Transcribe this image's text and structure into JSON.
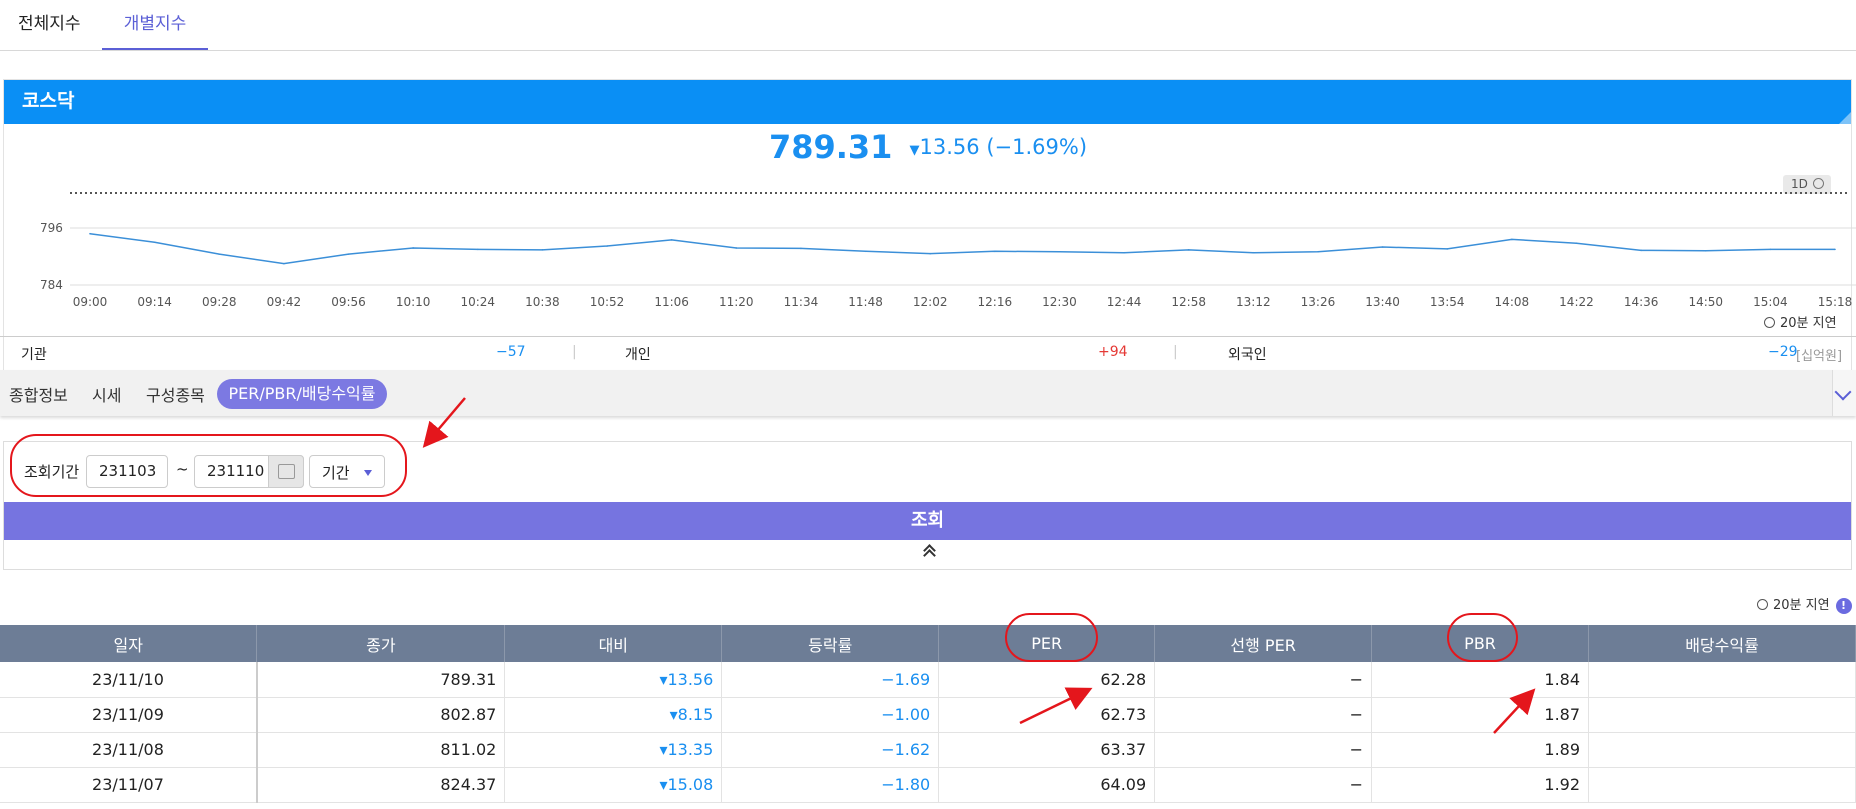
{
  "top_tabs": [
    "전체지수",
    "개별지수"
  ],
  "card": {
    "title": "코스닥",
    "price": "789.31",
    "change": "13.56",
    "change_rate": "(−1.69%)",
    "range_label": "1D"
  },
  "chart_data": {
    "type": "line",
    "x": [
      "09:00",
      "09:14",
      "09:28",
      "09:42",
      "09:56",
      "10:10",
      "10:24",
      "10:38",
      "10:52",
      "11:06",
      "11:20",
      "11:34",
      "11:48",
      "12:02",
      "12:16",
      "12:30",
      "12:44",
      "12:58",
      "13:12",
      "13:26",
      "13:40",
      "13:54",
      "14:08",
      "14:22",
      "14:36",
      "14:50",
      "15:04",
      "15:18"
    ],
    "y_ticks": [
      784,
      796
    ],
    "ylim": [
      784,
      796
    ],
    "series": [
      {
        "values": [
          794.8,
          793.0,
          790.5,
          788.5,
          790.5,
          791.8,
          791.5,
          791.4,
          792.2,
          793.5,
          791.8,
          791.7,
          791.1,
          790.6,
          791.1,
          791.0,
          790.8,
          791.4,
          790.8,
          791.0,
          792.0,
          791.6,
          793.6,
          792.8,
          791.3,
          791.2,
          791.5,
          791.5
        ]
      }
    ],
    "colors": {
      "line": "#3b8fd8"
    }
  },
  "delay_label": "20분 지연",
  "flows": {
    "inst_label": "기관",
    "inst_value": "−57",
    "indiv_label": "개인",
    "indiv_value": "+94",
    "foreign_label": "외국인",
    "foreign_value": "−29",
    "unit": "[십억원]"
  },
  "sub_tabs": [
    "종합정보",
    "시세",
    "구성종목",
    "PER/PBR/배당수익률"
  ],
  "query": {
    "label": "조회기간",
    "from_value": "231103",
    "tilde": "~",
    "to_value": "231110",
    "period_label": "기간",
    "search_label": "조회"
  },
  "table": {
    "headers": [
      "일자",
      "종가",
      "대비",
      "등락률",
      "PER",
      "선행 PER",
      "PBR",
      "배당수익률"
    ],
    "rows": [
      [
        "23/11/10",
        "789.31",
        "▾13.56",
        "−1.69",
        "62.28",
        "−",
        "1.84",
        ""
      ],
      [
        "23/11/09",
        "802.87",
        "▾8.15",
        "−1.00",
        "62.73",
        "−",
        "1.87",
        ""
      ],
      [
        "23/11/08",
        "811.02",
        "▾13.35",
        "−1.62",
        "63.37",
        "−",
        "1.89",
        ""
      ],
      [
        "23/11/07",
        "824.37",
        "▾15.08",
        "−1.80",
        "64.09",
        "−",
        "1.92",
        ""
      ]
    ]
  },
  "colors": {
    "accent": "#5b5fd6",
    "header_blue": "#0a8ff5",
    "down": "#1a8ff0",
    "up": "#e53935",
    "table_header": "#6d7d96",
    "search_button": "#7674e0",
    "annotation": "#e4161c"
  }
}
